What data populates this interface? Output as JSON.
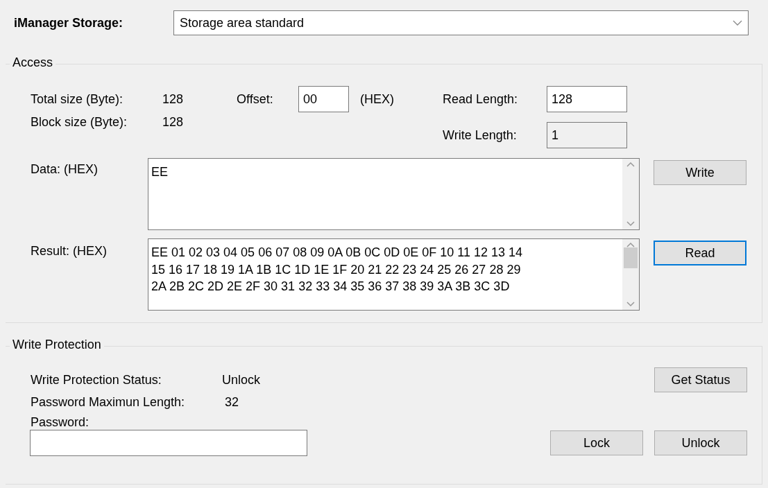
{
  "storage": {
    "label": "iManager Storage:",
    "value": "Storage area standard"
  },
  "access": {
    "title": "Access",
    "total_size": {
      "label": "Total size (Byte):",
      "value": "128"
    },
    "block_size": {
      "label": "Block size (Byte):",
      "value": "128"
    },
    "offset": {
      "label": "Offset:",
      "value": "00",
      "unit": "(HEX)"
    },
    "read_length": {
      "label": "Read Length:",
      "value": "128",
      "disabled": false
    },
    "write_length": {
      "label": "Write Length:",
      "value": "1",
      "disabled": true
    },
    "data": {
      "label": "Data: (HEX)",
      "value": "EE"
    },
    "result": {
      "label": "Result: (HEX)",
      "lines": [
        "EE 01 02 03 04 05 06 07 08 09 0A 0B 0C 0D 0E 0F 10 11 12 13 14",
        "15 16 17 18 19 1A 1B 1C 1D 1E 1F 20 21 22 23 24 25 26 27 28 29",
        "2A 2B 2C 2D 2E 2F 30 31 32 33 34 35 36 37 38 39 3A 3B 3C 3D"
      ]
    },
    "write_button": {
      "label": "Write",
      "focused": false
    },
    "read_button": {
      "label": "Read",
      "focused": true
    }
  },
  "write_protection": {
    "title": "Write Protection",
    "status": {
      "label": "Write Protection Status:",
      "value": "Unlock"
    },
    "max_length": {
      "label": "Password Maximun Length:",
      "value": "32"
    },
    "password": {
      "label": "Password:"
    },
    "get_status_button": {
      "label": "Get Status",
      "focused": false
    },
    "lock_button": {
      "label": "Lock",
      "focused": false
    },
    "unlock_button": {
      "label": "Unlock",
      "focused": false
    }
  }
}
